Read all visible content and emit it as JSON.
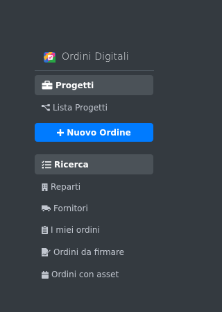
{
  "brand": {
    "title": "Ordini Digitali",
    "logo_icon": "multicolor-order-icon"
  },
  "projects_section": {
    "label": "Progetti",
    "icon": "briefcase-icon"
  },
  "project_items": [
    {
      "label": "Lista Progetti",
      "icon": "sitemap-icon"
    }
  ],
  "new_order_button": {
    "label": "Nuovo Ordine",
    "icon": "plus-icon",
    "color": "#007bff"
  },
  "search_section": {
    "label": "Ricerca",
    "icon": "list-check-icon"
  },
  "search_items": [
    {
      "label": "Reparti",
      "icon": "building-icon"
    },
    {
      "label": "Fornitori",
      "icon": "truck-icon"
    },
    {
      "label": "I miei ordini",
      "icon": "clipboard-list-icon"
    },
    {
      "label": "Ordini da firmare",
      "icon": "file-signature-icon"
    },
    {
      "label": "Ordini con asset",
      "icon": "calendar-icon"
    }
  ],
  "colors": {
    "sidebar_bg": "#343a40",
    "header_bg": "#4b5258",
    "text_muted": "#c2c7d0"
  }
}
